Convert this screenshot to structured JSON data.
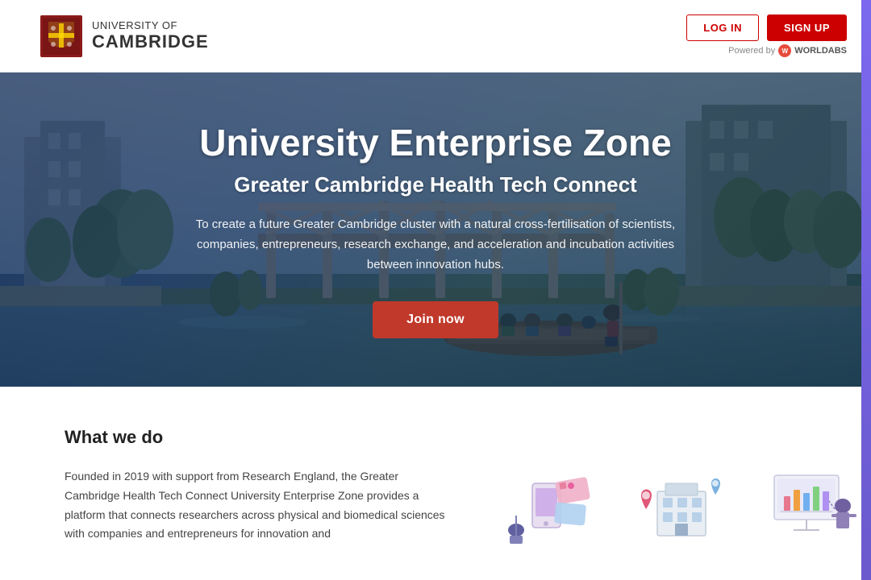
{
  "header": {
    "logo_university_of": "UNIVERSITY OF",
    "logo_cambridge": "CAMBRIDGE",
    "login_label": "LOG IN",
    "signup_label": "SIGN UP",
    "powered_by_text": "Powered by",
    "worldabs_label": "WORLDABS"
  },
  "hero": {
    "title": "University Enterprise Zone",
    "subtitle": "Greater Cambridge Health Tech Connect",
    "description": "To create a future Greater Cambridge cluster with a natural cross-fertilisation of scientists, companies, entrepreneurs, research exchange, and acceleration and incubation activities between innovation hubs.",
    "join_button_label": "Join now"
  },
  "what_we_do": {
    "section_title": "What we do",
    "body_text": "Founded in 2019 with support from Research England, the Greater Cambridge Health Tech Connect University Enterprise Zone provides a platform that connects researchers across physical and biomedical sciences with companies and entrepreneurs for innovation and"
  }
}
